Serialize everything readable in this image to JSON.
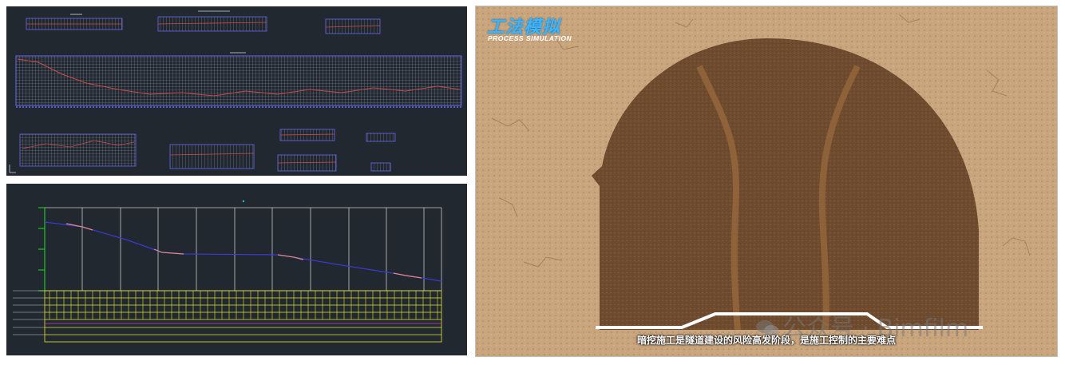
{
  "video": {
    "logo_cn": "工法模拟",
    "logo_en": "PROCESS SIMULATION",
    "subtitle": "暗挖施工是隧道建设的风险高发阶段，是施工控制的主要难点",
    "watermark": "公众号 · Bimfilm"
  },
  "colors": {
    "cad_bg": "#212830",
    "grid": "#c8c8c8",
    "profile_line": "#3a3ad0",
    "green_axis": "#22c322",
    "yellow_grid": "#e6e632",
    "logo_blue": "#3bb5ff"
  }
}
